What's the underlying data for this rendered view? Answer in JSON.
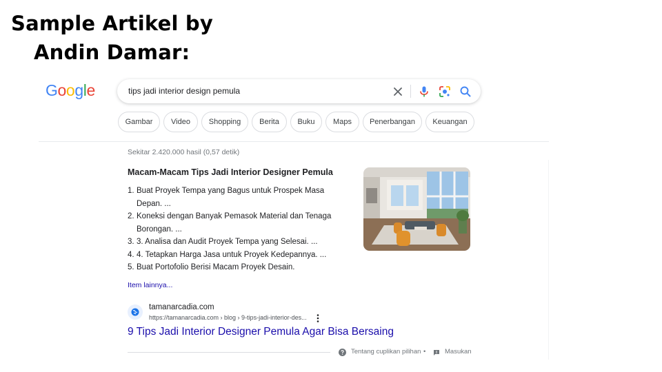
{
  "slide": {
    "title_line1": "Sample Artikel by",
    "title_line2": "Andin Damar:"
  },
  "logo": {
    "letters": [
      "G",
      "o",
      "o",
      "g",
      "l",
      "e"
    ],
    "colors": [
      "#4285F4",
      "#EA4335",
      "#FBBC05",
      "#4285F4",
      "#34A853",
      "#EA4335"
    ]
  },
  "search": {
    "query": "tips jadi interior design pemula",
    "icons": [
      "close-icon",
      "mic-icon",
      "lens-icon",
      "search-icon"
    ]
  },
  "chips": [
    "Gambar",
    "Video",
    "Shopping",
    "Berita",
    "Buku",
    "Maps",
    "Penerbangan",
    "Keuangan"
  ],
  "result_stats": "Sekitar 2.420.000 hasil (0,57 detik)",
  "snippet": {
    "title": "Macam-Macam Tips Jadi Interior Designer Pemula",
    "items": [
      {
        "num": "1.",
        "text": "Buat Proyek Tempa yang Bagus untuk Prospek Masa Depan. ..."
      },
      {
        "num": "2.",
        "text": "Koneksi dengan Banyak Pemasok Material dan Tenaga Borongan. ..."
      },
      {
        "num": "3.",
        "text": "3. Analisa dan Audit Proyek Tempa yang Selesai. ..."
      },
      {
        "num": "4.",
        "text": "4. Tetapkan Harga Jasa untuk Proyek Kedepannya. ..."
      },
      {
        "num": "5.",
        "text": "Buat Portofolio Berisi Macam Proyek Desain."
      }
    ],
    "more_link": "Item lainnya...",
    "image_icon": "living-room-photo"
  },
  "result": {
    "site_name": "tamanarcadia.com",
    "site_url": "https://tamanarcadia.com › blog › 9-tips-jadi-interior-des...",
    "title": "9 Tips Jadi Interior Designer Pemula Agar Bisa Bersaing"
  },
  "footer": {
    "about": "Tentang cuplikan pilihan",
    "separator": "•",
    "feedback": "Masukan"
  },
  "colors": {
    "link": "#1a0dab",
    "muted": "#70757a",
    "text": "#202124"
  }
}
